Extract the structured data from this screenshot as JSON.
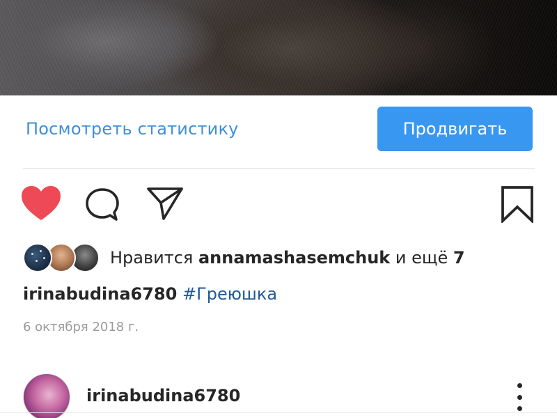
{
  "post": {
    "insights_link": "Посмотреть статистику",
    "promote_button": "Продвигать",
    "likes": {
      "prefix": "Нравится",
      "user": "annamashasemchuk",
      "middle": "и ещё",
      "count": "7"
    },
    "caption": {
      "username": "irinabudina6780",
      "hashtag": "#Греюшка"
    },
    "date": "6 октября 2018 г.",
    "icons": {
      "like": "heart-filled-icon",
      "comment": "comment-icon",
      "share": "paper-plane-icon",
      "save": "bookmark-icon",
      "more": "more-vertical-icon"
    }
  },
  "next_post": {
    "username": "irinabudina6780"
  },
  "colors": {
    "link_blue": "#3f8fd8",
    "button_blue": "#3897f0",
    "like_red": "#ed4956",
    "hashtag_blue": "#1f5a99",
    "text": "#262626",
    "muted": "#9a9a9a"
  }
}
